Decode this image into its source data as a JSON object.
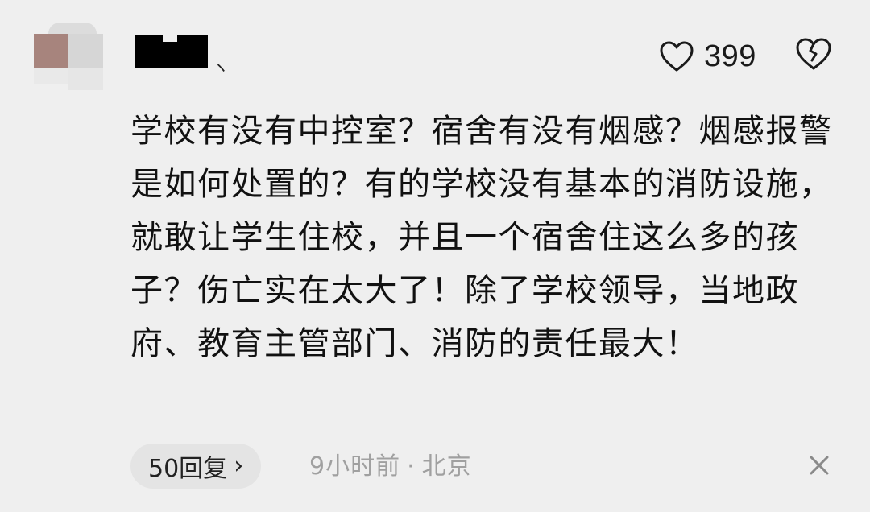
{
  "comment": {
    "like_count": "399",
    "text": "学校有没有中控室？宿舍有没有烟感？烟感报警是如何处置的？有的学校没有基本的消防设施，就敢让学生住校，并且一个宿舍住这么多的孩子？伤亡实在太大了！除了学校领导，当地政府、教育主管部门、消防的责任最大！",
    "replies_label": "50回复",
    "reply_chevron": "›",
    "time": "9小时前",
    "separator": "·",
    "location": "北京"
  },
  "icons": {
    "like": "heart-outline-icon",
    "dislike": "broken-heart-icon",
    "close": "close-icon",
    "chevron": "chevron-right-icon"
  },
  "colors": {
    "background": "#efefef",
    "text": "#111111",
    "meta": "#a0a0a0",
    "pill": "#e4e4e4"
  }
}
